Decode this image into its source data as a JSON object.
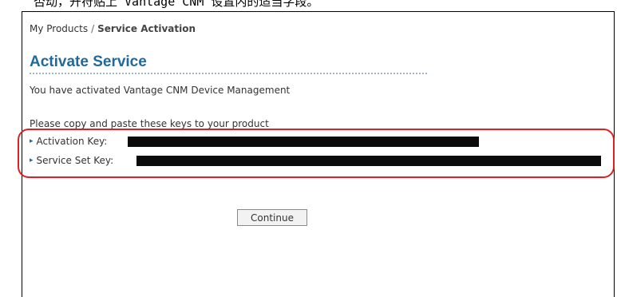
{
  "caption": "否动，开符贴上 Vantage CNM 设置内的适当字段。",
  "breadcrumb": {
    "root": "My Products",
    "separator": "/",
    "current": "Service Activation"
  },
  "page": {
    "title": "Activate Service"
  },
  "message": "You have activated Vantage CNM Device Management",
  "instruction": "Please copy and paste these keys to your product",
  "keys": {
    "activation_label": "Activation Key:",
    "service_set_label": "Service Set Key:"
  },
  "actions": {
    "continue_label": "Continue"
  },
  "colors": {
    "title": "#1f6a9b",
    "highlight": "#e02020",
    "redaction": "#0b0b0b"
  }
}
